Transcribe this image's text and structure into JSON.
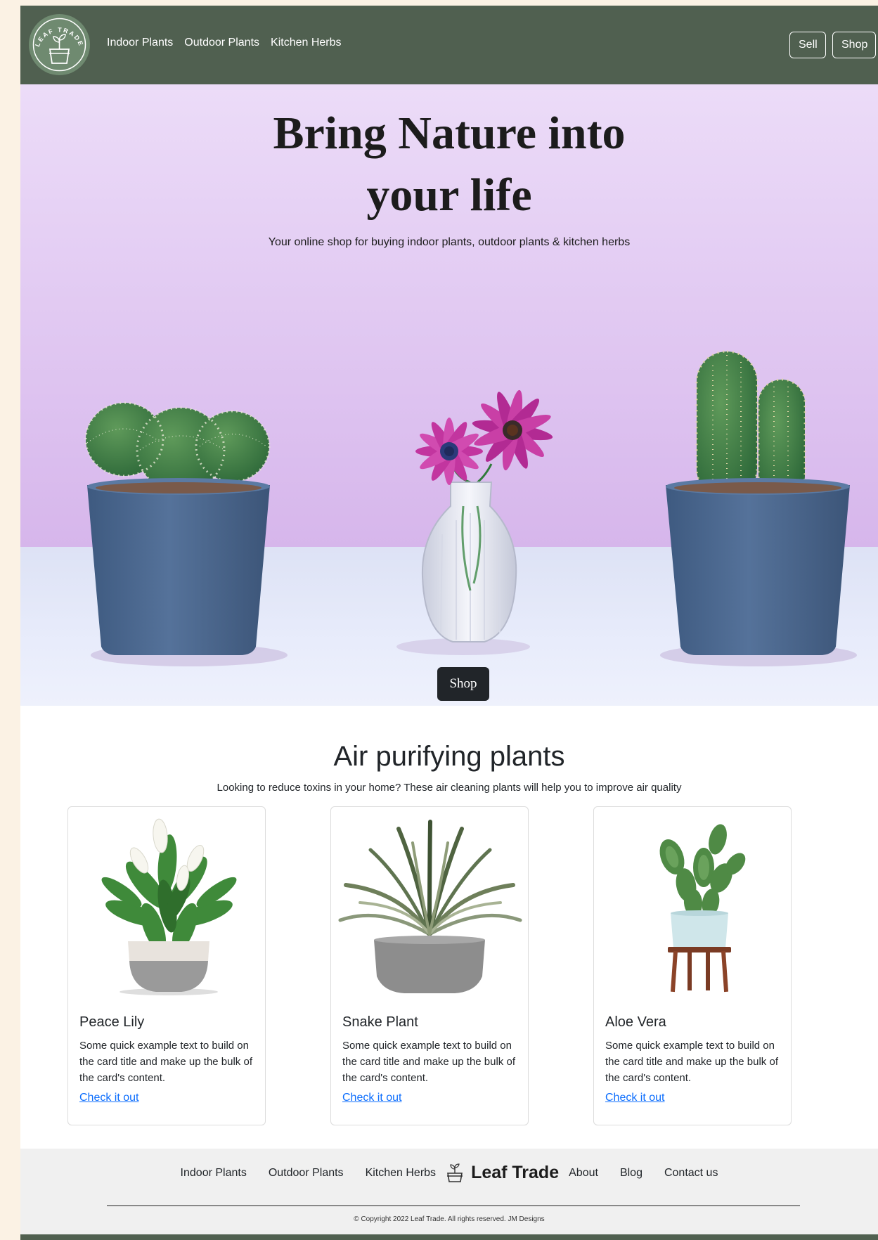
{
  "brand": {
    "logo_text": "LEAF TRADE",
    "name": "Leaf Trade"
  },
  "navbar": {
    "links": [
      "Indoor Plants",
      "Outdoor Plants",
      "Kitchen Herbs"
    ],
    "sell_label": "Sell",
    "shop_label": "Shop"
  },
  "hero": {
    "title_line1": "Bring Nature into",
    "title_line2": "your life",
    "subtitle": "Your online shop for buying indoor plants, outdoor plants & kitchen herbs",
    "shop_label": "Shop"
  },
  "section": {
    "title": "Air purifying plants",
    "subtitle": "Looking to reduce toxins in your home? These air cleaning plants will help you to improve air quality"
  },
  "cards": [
    {
      "title": "Peace Lily",
      "text": "Some quick example text to build on the card title and make up the bulk of the card's content.",
      "link": "Check it out"
    },
    {
      "title": "Snake Plant",
      "text": "Some quick example text to build on the card title and make up the bulk of the card's content.",
      "link": "Check it out"
    },
    {
      "title": "Aloe Vera",
      "text": "Some quick example text to build on the card title and make up the bulk of the card's content.",
      "link": "Check it out"
    }
  ],
  "footer": {
    "left_links": [
      "Indoor Plants",
      "Outdoor Plants",
      "Kitchen Herbs"
    ],
    "right_links": [
      "About",
      "Blog",
      "Contact us"
    ],
    "copyright": "© Copyright 2022 Leaf Trade. All rights reserved. JM Designs"
  },
  "colors": {
    "navbar": "#506050",
    "logo": "#6f8a70",
    "hero_background": "#dcc0ef",
    "pot": "#4e6b92",
    "dark_button": "#212529",
    "link": "#0d6efd",
    "footer_background": "#f0f0f0",
    "page_background": "#fbf2e4"
  },
  "icons": {
    "logo": "plant-pot-icon",
    "footer_brand": "plant-pot-icon"
  }
}
